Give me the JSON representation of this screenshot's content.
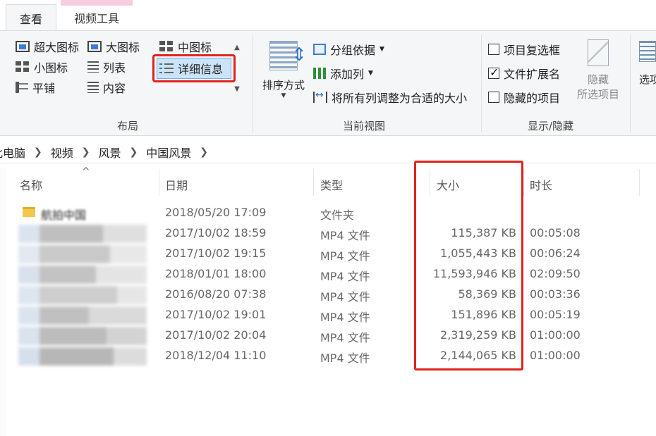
{
  "tabs": {
    "view": "查看",
    "video_tools": "视频工具"
  },
  "ribbon": {
    "layout": {
      "items": [
        "超大图标",
        "大图标",
        "中图标",
        "小图标",
        "列表",
        "详细信息",
        "平铺",
        "内容"
      ],
      "label": "布局"
    },
    "current_view": {
      "sort_by": "排序方式",
      "group_by": "分组依据",
      "add_columns": "添加列",
      "size_all_columns": "将所有列调整为合适的大小",
      "label": "当前视图"
    },
    "show_hide": {
      "item_checkboxes": "项目复选框",
      "file_extensions": "文件扩展名",
      "hidden_items": "隐藏的项目",
      "hide_selected_line1": "隐藏",
      "hide_selected_line2": "所选项目",
      "options": "选项",
      "label": "显示/隐藏",
      "checked": {
        "item_checkboxes": false,
        "file_extensions": true,
        "hidden_items": false
      }
    }
  },
  "breadcrumb": [
    "此电脑",
    "视频",
    "风景",
    "中国风景"
  ],
  "columns": {
    "name": "名称",
    "date": "日期",
    "type": "类型",
    "size": "大小",
    "duration": "时长"
  },
  "files": [
    {
      "name": "航拍中国",
      "date": "2018/05/20 17:09",
      "type": "文件夹",
      "size": "",
      "duration": ""
    },
    {
      "name": "",
      "date": "2017/10/02 18:59",
      "type": "MP4 文件",
      "size": "115,387 KB",
      "duration": "00:05:08"
    },
    {
      "name": "",
      "date": "2017/10/02 19:15",
      "type": "MP4 文件",
      "size": "1,055,443 KB",
      "duration": "00:06:24"
    },
    {
      "name": "",
      "date": "2018/01/01 18:00",
      "type": "MP4 文件",
      "size": "11,593,946 KB",
      "duration": "02:09:50"
    },
    {
      "name": "",
      "date": "2016/08/20 07:38",
      "type": "MP4 文件",
      "size": "58,369 KB",
      "duration": "00:03:36"
    },
    {
      "name": "",
      "date": "2017/10/02 19:01",
      "type": "MP4 文件",
      "size": "151,896 KB",
      "duration": "00:05:19"
    },
    {
      "name": "",
      "date": "2017/10/02 20:04",
      "type": "MP4 文件",
      "size": "2,319,259 KB",
      "duration": "01:00:00"
    },
    {
      "name": "",
      "date": "2018/12/04 11:10",
      "type": "MP4 文件",
      "size": "2,144,065 KB",
      "duration": "01:00:00"
    }
  ],
  "colors": {
    "highlight": "#e0231c",
    "selected_fill": "#cce4f7",
    "video_tab_accent": "#f6cde0"
  }
}
